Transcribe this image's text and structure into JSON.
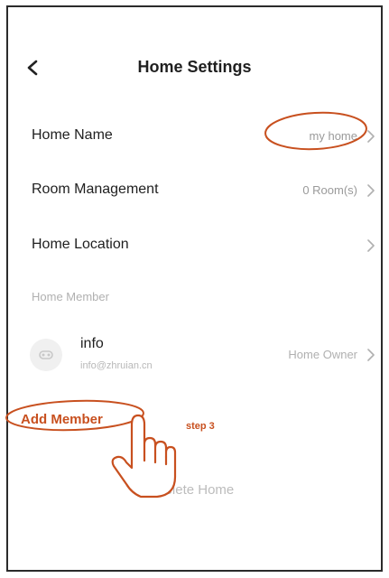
{
  "header": {
    "title": "Home Settings",
    "back_icon": "chevron-left-icon"
  },
  "rows": [
    {
      "label": "Home Name",
      "value": "my home"
    },
    {
      "label": "Room Management",
      "value": "0 Room(s)"
    },
    {
      "label": "Home Location",
      "value": ""
    }
  ],
  "member_section": {
    "label": "Home Member",
    "members": [
      {
        "name": "info",
        "email": "info@zhruian.cn",
        "role": "Home Owner"
      }
    ]
  },
  "add_member": {
    "label": "Add Member"
  },
  "annotation": {
    "step": "step 3",
    "pointer_icon": "hand-pointer-icon",
    "color": "#c8501f"
  },
  "delete_home": {
    "label": "Delete Home"
  }
}
